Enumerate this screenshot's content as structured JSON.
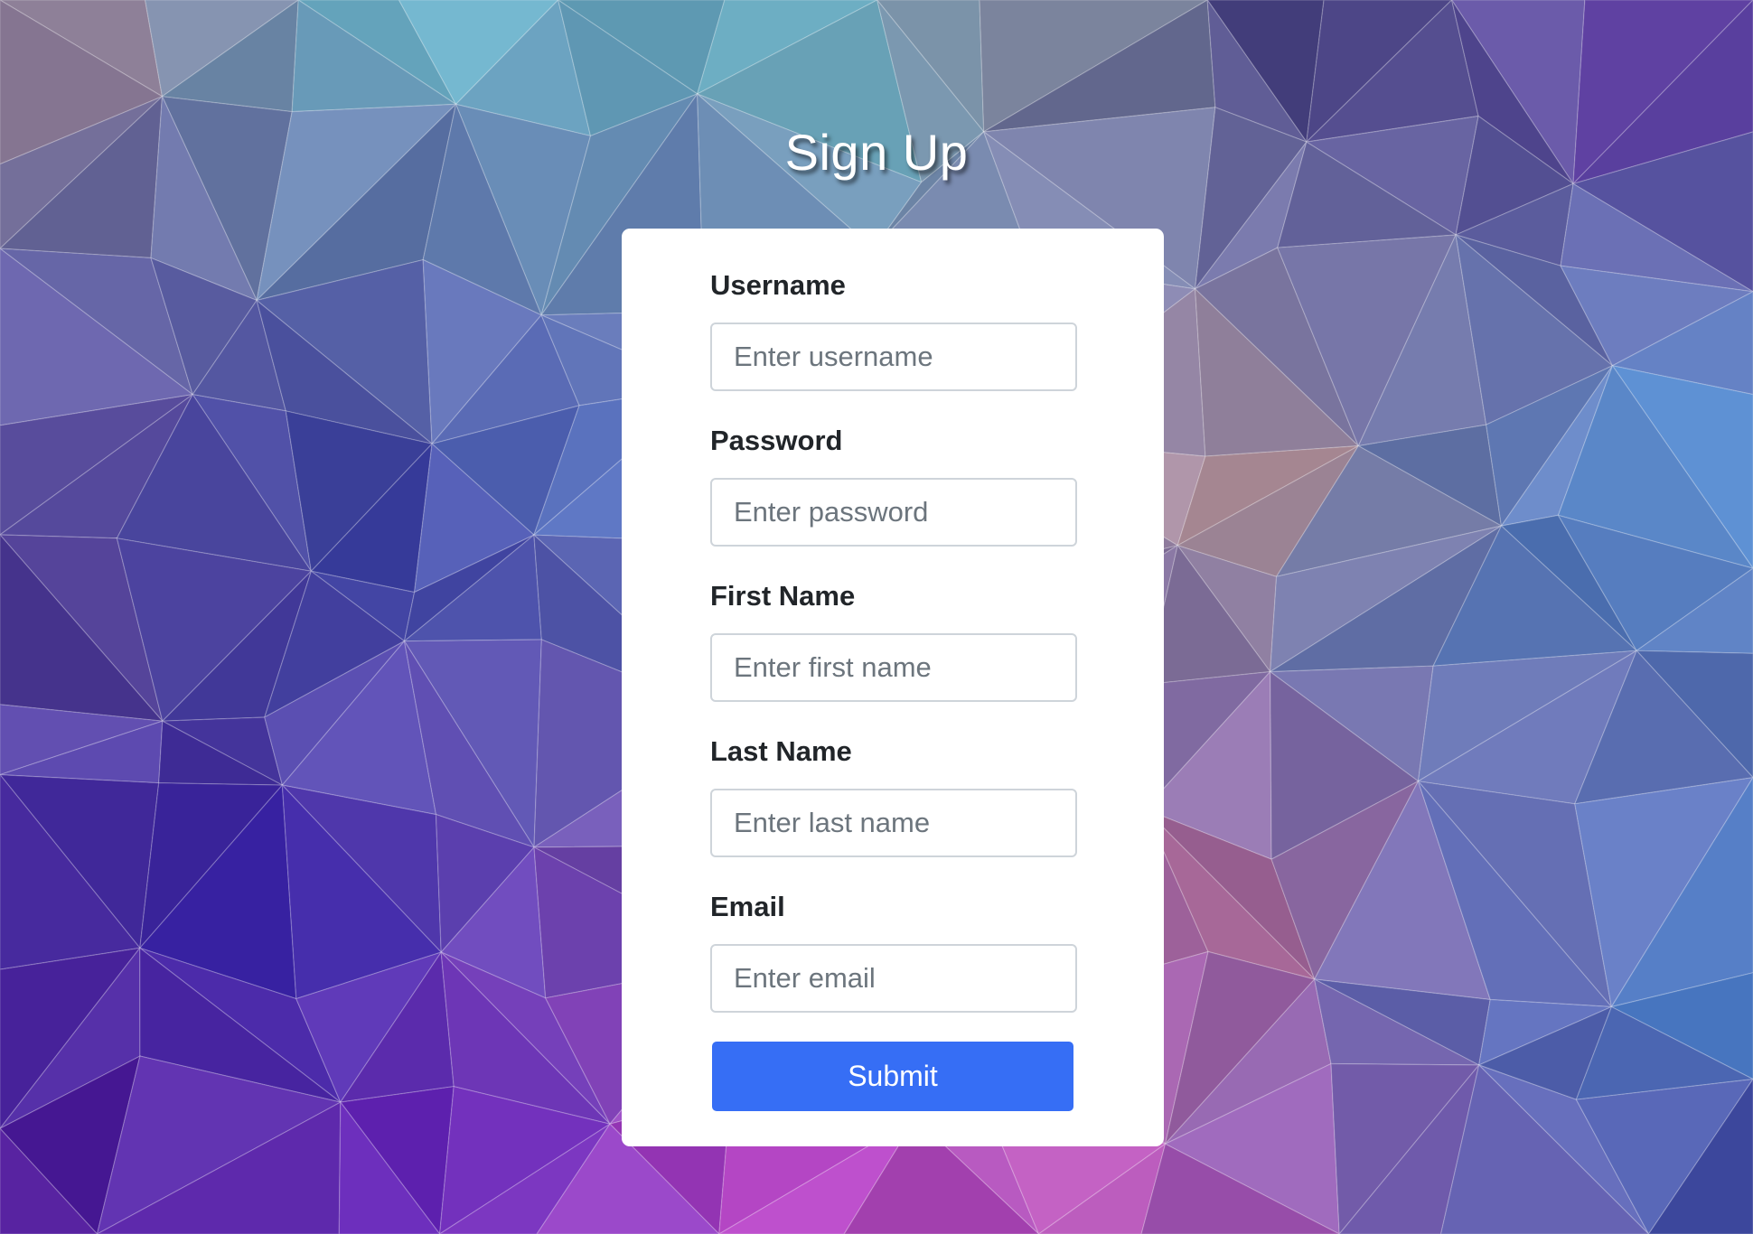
{
  "page": {
    "title": "Sign Up"
  },
  "form": {
    "fields": [
      {
        "label": "Username",
        "placeholder": "Enter username",
        "value": ""
      },
      {
        "label": "Password",
        "placeholder": "Enter password",
        "value": ""
      },
      {
        "label": "First Name",
        "placeholder": "Enter first name",
        "value": ""
      },
      {
        "label": "Last Name",
        "placeholder": "Enter last name",
        "value": ""
      },
      {
        "label": "Email",
        "placeholder": "Enter email",
        "value": ""
      }
    ],
    "submit_label": "Submit"
  },
  "colors": {
    "accent": "#366ef5",
    "card_background": "#ffffff",
    "label_text": "#212529",
    "input_border": "#ced4da"
  }
}
